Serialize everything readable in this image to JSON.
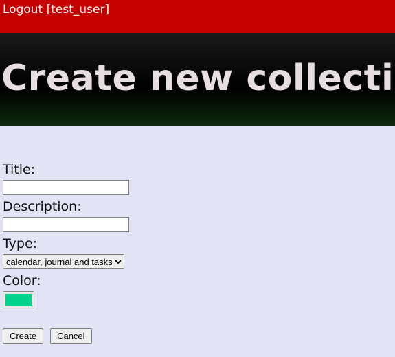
{
  "topbar": {
    "logout_text": "Logout [test_user]"
  },
  "hero": {
    "title": "Create new collection"
  },
  "form": {
    "title_label": "Title:",
    "title_value": "",
    "description_label": "Description:",
    "description_value": "",
    "type_label": "Type:",
    "type_selected": "calendar, journal and tasks",
    "type_options": [
      "calendar, journal and tasks"
    ],
    "color_label": "Color:",
    "color_value": "#00d48c"
  },
  "buttons": {
    "create": "Create",
    "cancel": "Cancel"
  }
}
